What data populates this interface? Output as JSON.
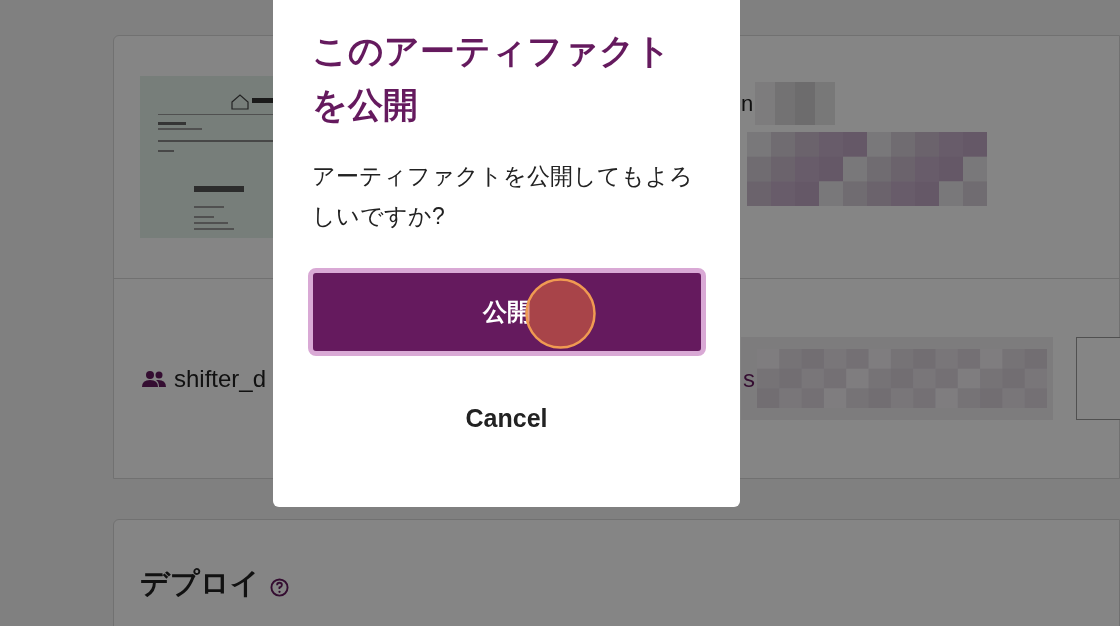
{
  "dialog": {
    "title": "このアーティファクトを公開",
    "message": "アーティファクトを公開してもよろしいですか?",
    "confirm_button": "公開",
    "cancel_button": "Cancel"
  },
  "background": {
    "artifact_card": {
      "fragment": "n"
    },
    "owner_row": {
      "name": "shifter_d",
      "fragment": "s"
    },
    "deploy_section": {
      "title": "デプロイ"
    }
  }
}
